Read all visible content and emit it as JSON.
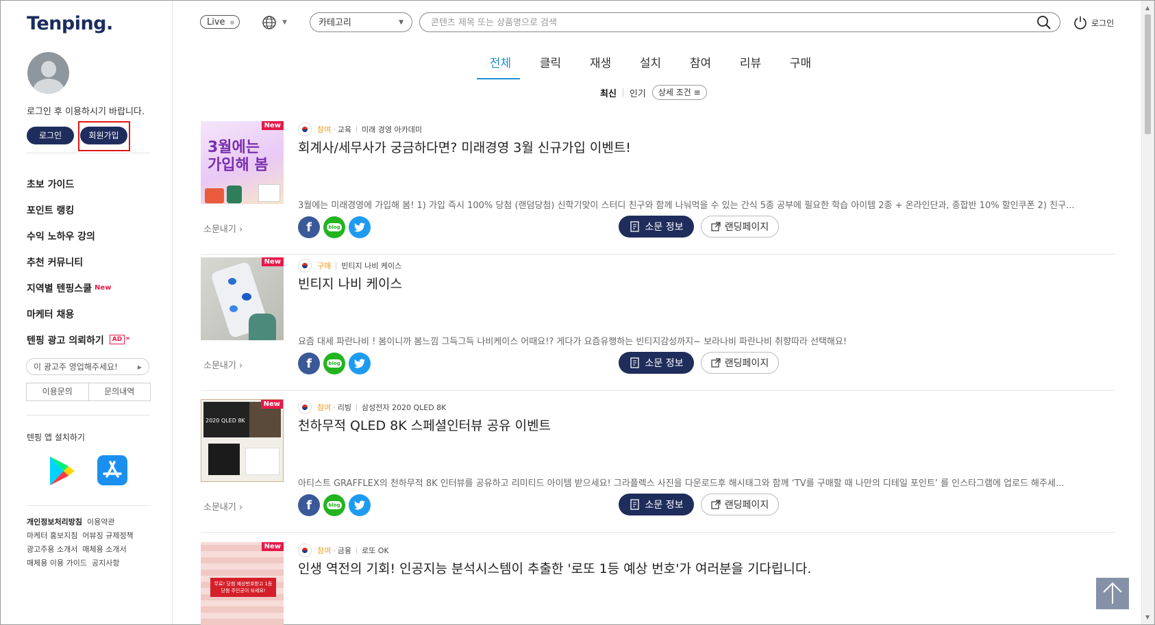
{
  "brand": {
    "logo": "Tenping."
  },
  "sidebar": {
    "login_message": "로그인 후 이용하시기 바랍니다.",
    "login_label": "로그인",
    "join_label": "회원가입",
    "menu": [
      {
        "label": "초보 가이드"
      },
      {
        "label": "포인트 랭킹"
      },
      {
        "label": "수익 노하우 강의"
      },
      {
        "label": "추천 커뮤니티"
      },
      {
        "label": "지역별 텐핑스쿨",
        "badge": "New"
      },
      {
        "label": "마케터 채용"
      },
      {
        "label": "텐핑 광고 의뢰하기",
        "badge": "AD"
      }
    ],
    "ad_prompt": "이 광고주 영업해주세요!",
    "inquiry_label": "이용문의",
    "inquiry_history_label": "문의내역",
    "app_install_label": "텐핑 앱 설치하기",
    "footer_links": [
      "개인정보처리방침",
      "이용약관",
      "마케터 홍보지침",
      "어뷰징 규제정책",
      "광고주용 소개서",
      "매체용 소개서",
      "매체용 이용 가이드",
      "공지사항"
    ]
  },
  "header": {
    "live_label": "Live",
    "category_label": "카테고리",
    "search_placeholder": "콘텐츠 제목 또는 상품명으로 검색",
    "login_label": "로그인"
  },
  "tabs": [
    "전체",
    "클릭",
    "재생",
    "설치",
    "참여",
    "리뷰",
    "구매"
  ],
  "active_tab": "전체",
  "sorts": {
    "latest": "최신",
    "popular": "인기",
    "detail": "상세 조건"
  },
  "feed": [
    {
      "badge": "New",
      "category": "참여",
      "subcategory": "교육",
      "advertiser": "미래 경영 아카데미",
      "title": "회계사/세무사가 궁금하다면? 미래경영 3월 신규가입 이벤트!",
      "description": "3월에는 미래경영에 가입해 봄! 1) 가입 즉시 100% 당첨 (랜덤당첨) 신학기맞이 스터디 친구와 함께 나눠먹을 수 있는 간식 5종 공부에 필요한 학습 아이템 2종 + 온라인단과, 종합반 10% 할인쿠폰 2) 친구...",
      "thumb_text": "3월에는 가입해 봄",
      "share_label": "소문내기",
      "info_label": "소문 정보",
      "landing_label": "랜딩페이지"
    },
    {
      "badge": "New",
      "category": "구매",
      "subcategory": "",
      "advertiser": "빈티지 나비 케이스",
      "title": "빈티지 나비 케이스",
      "description": "요즘 대세 파란나비 ! 봄이니까 봄느낌 그득그득 나비케이스 어때요!? 게다가 요즘유행하는 빈티지감성까지~ 보라나비 파란나비 취향따라 선택해요!",
      "thumb_text": "",
      "share_label": "소문내기",
      "info_label": "소문 정보",
      "landing_label": "랜딩페이지"
    },
    {
      "badge": "New",
      "category": "참여",
      "subcategory": "리빙",
      "advertiser": "삼성전자 2020 QLED 8K",
      "title": "천하무적 QLED 8K 스페셜인터뷰 공유 이벤트",
      "description": "아티스트 GRAFFLEX의 천하무적 8K 인터뷰를 공유하고 리미티드 아이템 받으세요! 그라플렉스 사진을 다운로드후 해시태그와 함께 ‘TV를 구매할 때 나만의 디테일 포인트’ 를 인스타그램에 업로드 해주세...",
      "thumb_text": "2020 QLED 8K",
      "share_label": "소문내기",
      "info_label": "소문 정보",
      "landing_label": "랜딩페이지"
    },
    {
      "badge": "New",
      "category": "참여",
      "subcategory": "금융",
      "advertiser": "로또 OK",
      "title": "인생 역전의 기회! 인공지능 분석시스템이 추출한 '로또 1등 예상 번호'가 여러분을 기다립니다.",
      "description": "",
      "thumb_text": "무료! 당첨 예상번호받고 1등 당첨 주인공이 되세요!",
      "share_label": "",
      "info_label": "",
      "landing_label": ""
    }
  ],
  "colors": {
    "brand_navy": "#1f2d5c",
    "tab_active": "#1e8fd6",
    "category_orange": "#f29a21",
    "new_badge": "#e6194a"
  }
}
